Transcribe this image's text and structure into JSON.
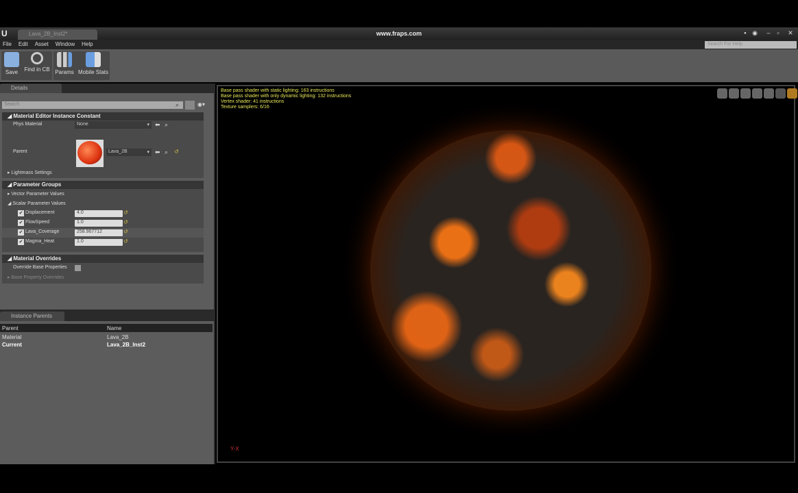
{
  "window": {
    "tab_title": "Lava_2B_Inst2*",
    "title": "www.fraps.com",
    "menu": [
      "File",
      "Edit",
      "Asset",
      "Window",
      "Help"
    ],
    "help_search_placeholder": "Search For Help"
  },
  "toolbar": {
    "buttons": [
      {
        "label": "Save",
        "icon": "save-icon"
      },
      {
        "label": "Find in CB",
        "icon": "magnifier-icon"
      },
      {
        "label": "Params",
        "icon": "params-icon"
      },
      {
        "label": "Mobile Stats",
        "icon": "mobile-stats-icon"
      }
    ]
  },
  "details": {
    "tab": "Details",
    "search_placeholder": "Search",
    "instance_constant": {
      "title": "Material Editor Instance Constant",
      "phys_material_label": "Phys Material",
      "phys_material_value": "None",
      "parent_label": "Parent",
      "parent_value": "Lava_2B",
      "lightmass": "Lightmass Settings"
    },
    "parameter_groups": {
      "title": "Parameter Groups",
      "vector": "Vector Parameter Values",
      "scalar": "Scalar Parameter Values",
      "params": [
        {
          "name": "Displacement",
          "value": "4.0",
          "checked": true
        },
        {
          "name": "FlowSpeed",
          "value": "1.0",
          "checked": true
        },
        {
          "name": "Lava_Coverage",
          "value": "258.967712",
          "checked": true
        },
        {
          "name": "Magma_Heat",
          "value": "1.0",
          "checked": true
        }
      ]
    },
    "overrides": {
      "title": "Material Overrides",
      "override_label": "Override Base Properties",
      "base_property": "Base Property Overrides"
    }
  },
  "instance_parents": {
    "tab": "Instance Parents",
    "columns": [
      "Parent",
      "Name"
    ],
    "rows": [
      [
        "Material",
        "Lava_2B"
      ],
      [
        "Current",
        "Lava_2B_Inst2"
      ]
    ]
  },
  "viewport": {
    "stats": [
      "Base pass shader with static lighting: 163 instructions",
      "Base pass shader with only dynamic lighting: 132 instructions",
      "Vertex shader: 41 instructions",
      "Texture samplers: 6/16"
    ],
    "axis": "Y-X"
  },
  "colors": {
    "stats_text": "#e8e85a",
    "accent": "#d8a030"
  }
}
